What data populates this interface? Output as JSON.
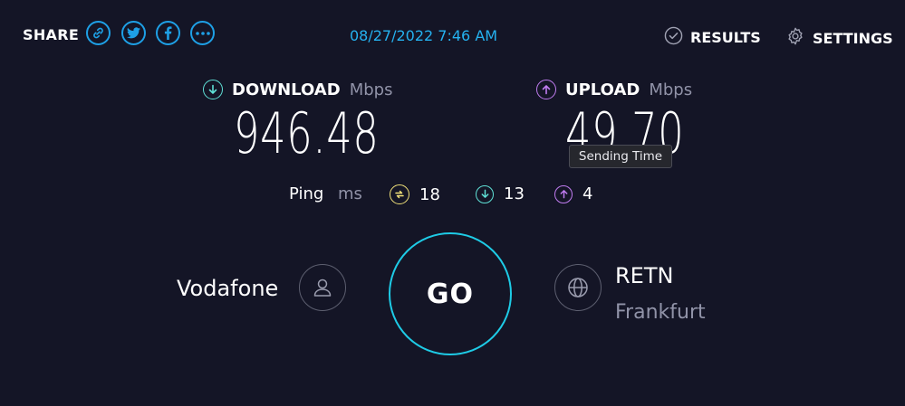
{
  "header": {
    "share_label": "SHARE",
    "share_icons": [
      "link-icon",
      "twitter-icon",
      "facebook-icon",
      "more-icon"
    ],
    "datetime": "08/27/2022 7:46 AM",
    "results_label": "RESULTS",
    "settings_label": "SETTINGS"
  },
  "download": {
    "label": "DOWNLOAD",
    "unit": "Mbps",
    "value": "946.48"
  },
  "upload": {
    "label": "UPLOAD",
    "unit": "Mbps",
    "value": "49.70"
  },
  "tooltip": "Sending Time",
  "ping": {
    "label": "Ping",
    "unit": "ms",
    "idle": "18",
    "download": "13",
    "upload": "4"
  },
  "provider": {
    "name": "Vodafone"
  },
  "go_label": "GO",
  "server": {
    "name": "RETN",
    "location": "Frankfurt"
  },
  "colors": {
    "accent": "#1ecbe6",
    "download": "#5fe0d6",
    "upload": "#c07cf0",
    "ping_idle": "#f2e27a",
    "background": "#141526"
  }
}
